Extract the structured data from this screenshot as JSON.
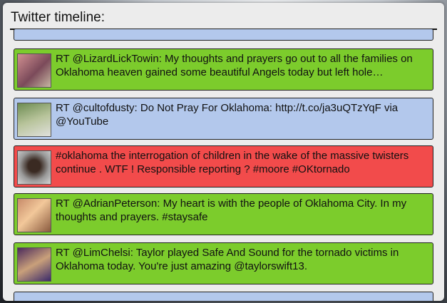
{
  "panel": {
    "title": "Twitter timeline:"
  },
  "colors": {
    "green": "#7ccc2c",
    "blue": "#b3c8ec",
    "red": "#f24b4b"
  },
  "tweets": [
    {
      "color": "blue",
      "text": "",
      "avatar": "person-photo"
    },
    {
      "color": "green",
      "text": "RT @LizardLickTowin: My thoughts and prayers go out to all the families on Oklahoma heaven gained some beautiful Angels today but left hole…",
      "avatar": "person-photo"
    },
    {
      "color": "blue",
      "text": "RT @cultofdusty: Do Not Pray For Oklahoma: http://t.co/ja3uQTzYqF via @YouTube",
      "avatar": "person-photo"
    },
    {
      "color": "red",
      "text": "#oklahoma the interrogation of children in the wake of the massive twisters continue . WTF ! Responsible reporting ? #moore #OKtornado",
      "avatar": "person-photo"
    },
    {
      "color": "green",
      "text": "RT @AdrianPeterson: My heart is with the people of Oklahoma City. In my thoughts and prayers. #staysafe",
      "avatar": "person-photo"
    },
    {
      "color": "green",
      "text": "RT @LimChelsi: Taylor played Safe And Sound for the tornado victims in Oklahoma today. You're just amazing @taylorswift13.",
      "avatar": "person-photo"
    },
    {
      "color": "blue",
      "text": "",
      "avatar": "person-photo"
    }
  ]
}
